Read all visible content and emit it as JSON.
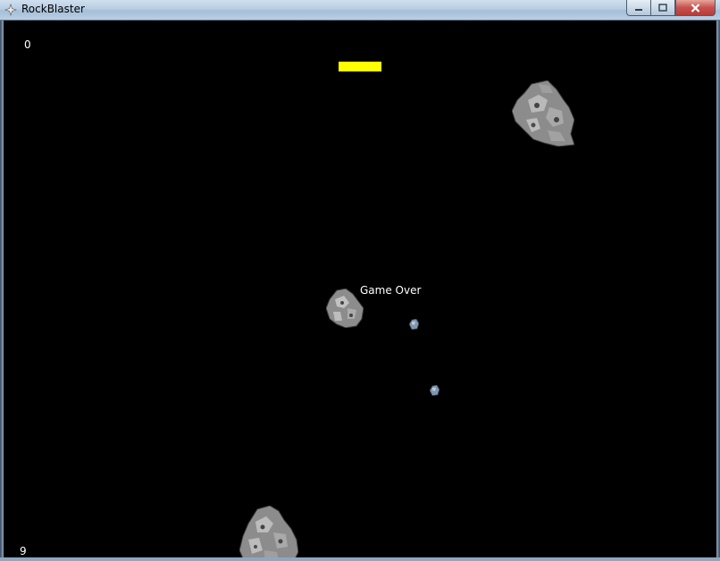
{
  "window": {
    "title": "RockBlaster",
    "icon": "starburst-app-icon",
    "controls": [
      "minimize-icon",
      "maximize-icon",
      "close-icon"
    ]
  },
  "hud": {
    "score": "0",
    "lives": "9",
    "status": "Game Over"
  },
  "colors": {
    "background": "#000000",
    "ship": "#ffff00",
    "text": "#ffffff",
    "rock": "#8c8c8c",
    "debris": "#7f96b0"
  }
}
